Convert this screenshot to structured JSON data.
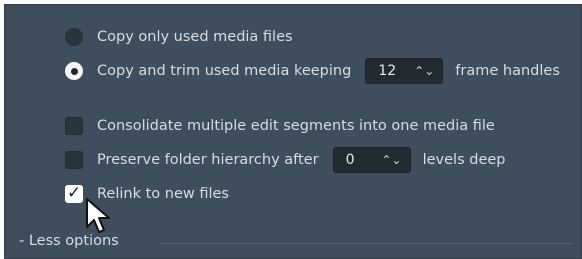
{
  "options": {
    "copy_only": {
      "label": "Copy only used media files",
      "checked": false
    },
    "copy_trim": {
      "label_before": "Copy and trim used media keeping",
      "value": "12",
      "label_after": "frame handles",
      "checked": true
    },
    "consolidate": {
      "label": "Consolidate multiple edit segments into one media file",
      "checked": false
    },
    "preserve": {
      "label_before": "Preserve folder hierarchy after",
      "value": "0",
      "label_after": "levels deep",
      "checked": false
    },
    "relink": {
      "label": "Relink to new files",
      "checked": true
    }
  },
  "less_options_label": "- Less options",
  "icons": {
    "stepper": "up-down-chevron-icon",
    "cursor": "mouse-pointer-icon",
    "check": "checkmark-icon"
  },
  "colors": {
    "panel": "#3f4e5c",
    "text": "#d6dde3",
    "field": "#222a32",
    "control": "#2a343d"
  }
}
